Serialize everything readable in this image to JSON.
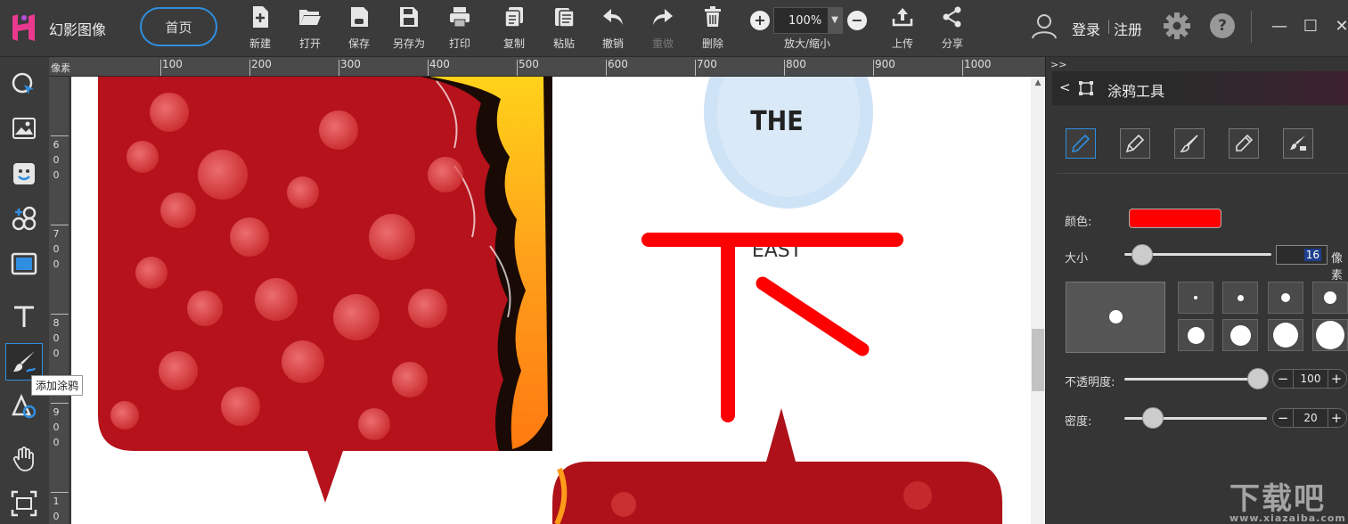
{
  "app": {
    "name": "幻影图像",
    "home_label": "首页"
  },
  "toolbar": {
    "items": [
      {
        "id": "new",
        "label": "新建",
        "icon": "file-plus-icon"
      },
      {
        "id": "open",
        "label": "打开",
        "icon": "folder-open-icon"
      },
      {
        "id": "save",
        "label": "保存",
        "icon": "save-icon"
      },
      {
        "id": "save_as",
        "label": "另存为",
        "icon": "save-as-icon"
      },
      {
        "id": "print",
        "label": "打印",
        "icon": "printer-icon"
      },
      {
        "id": "copy",
        "label": "复制",
        "icon": "copy-icon"
      },
      {
        "id": "paste",
        "label": "粘贴",
        "icon": "paste-icon"
      },
      {
        "id": "undo",
        "label": "撤销",
        "icon": "undo-icon"
      },
      {
        "id": "redo",
        "label": "重做",
        "icon": "redo-icon",
        "disabled": true
      },
      {
        "id": "delete",
        "label": "删除",
        "icon": "trash-icon"
      }
    ],
    "zoom": {
      "value": "100%",
      "label": "放大/缩小"
    },
    "upload_label": "上传",
    "share_label": "分享"
  },
  "account": {
    "login": "登录",
    "register": "注册",
    "help": "?"
  },
  "window": {
    "minimize": "—",
    "maximize": "☐",
    "close": "✕"
  },
  "left_tools": {
    "tooltip": "添加涂鸦",
    "items": [
      "select-icon",
      "image-icon",
      "sticker-icon",
      "shapes-icon",
      "frame-icon",
      "text-icon",
      "brush-icon",
      "draw-shape-icon",
      "hand-icon",
      "crop-icon"
    ],
    "active": "brush-icon"
  },
  "rulers": {
    "unit": "像素",
    "top_labels": [
      "100",
      "200",
      "300",
      "400",
      "500",
      "600",
      "700",
      "800",
      "900",
      "1000"
    ],
    "left_labels": [
      [
        "6",
        "0",
        "0"
      ],
      [
        "7",
        "0",
        "0"
      ],
      [
        "8",
        "0",
        "0"
      ],
      [
        "9",
        "0",
        "0"
      ],
      [
        "1",
        "0"
      ]
    ]
  },
  "canvas": {
    "moon_text_1": "THE",
    "moon_text_2": "EAST",
    "stroke_color": "#ff0000"
  },
  "panel": {
    "collapse": ">>",
    "back": "<",
    "title": "涂鸦工具",
    "brushes": [
      "pencil-icon",
      "marker-icon",
      "paintbrush-icon",
      "crayon-icon",
      "eraser-brush-icon"
    ],
    "active_brush": "pencil-icon",
    "color_label": "颜色:",
    "color_value": "#ff0000",
    "size_label": "大小",
    "size_value": "16",
    "size_unit": "像素",
    "size_slider": 0.12,
    "opacity_label": "不透明度:",
    "opacity_value": "100",
    "opacity_slider": 1.0,
    "density_label": "密度:",
    "density_value": "20",
    "density_slider": 0.2,
    "step_minus": "−",
    "step_plus": "+"
  },
  "watermark": {
    "title": "下载吧",
    "sub": "www.xiazaiba.com"
  }
}
